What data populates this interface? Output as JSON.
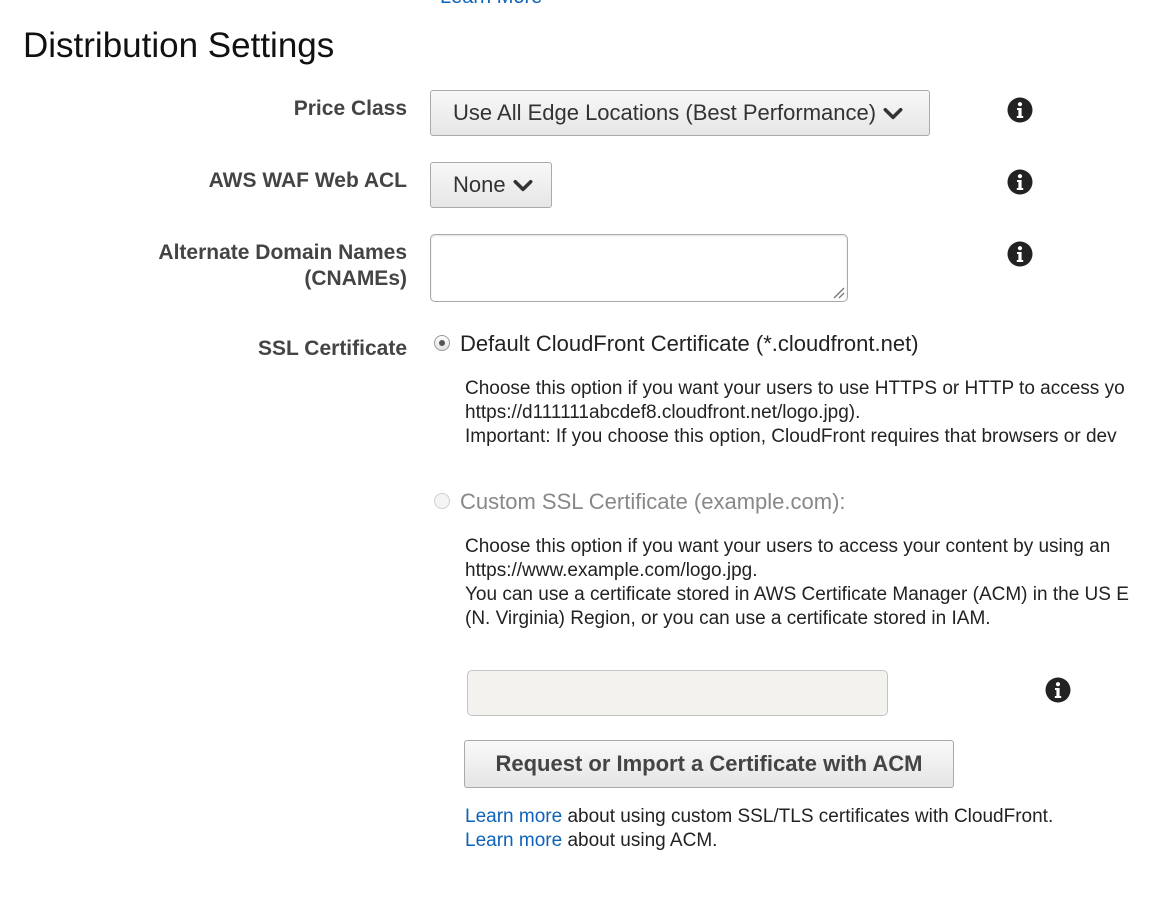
{
  "top_link": "Learn More",
  "section_title": "Distribution Settings",
  "price_class": {
    "label": "Price Class",
    "value": "Use All Edge Locations (Best Performance)"
  },
  "waf": {
    "label": "AWS WAF Web ACL",
    "value": "None"
  },
  "cnames": {
    "label_line1": "Alternate Domain Names",
    "label_line2": "(CNAMEs)",
    "value": ""
  },
  "ssl": {
    "label": "SSL Certificate",
    "default_option": {
      "label": "Default CloudFront Certificate (*.cloudfront.net)",
      "selected": true,
      "desc_line1": "Choose this option if you want your users to use HTTPS or HTTP to access yo",
      "desc_line2": "https://d111111abcdef8.cloudfront.net/logo.jpg).",
      "desc_line3": "Important: If you choose this option, CloudFront requires that browsers or dev"
    },
    "custom_option": {
      "label": "Custom SSL Certificate (example.com):",
      "selected": false,
      "disabled": true,
      "desc_line1": "Choose this option if you want your users to access your content by using an",
      "desc_line2": "https://www.example.com/logo.jpg.",
      "desc_line3": "You can use a certificate stored in AWS Certificate Manager (ACM) in the US E",
      "desc_line4": "(N. Virginia) Region, or you can use a certificate stored in IAM."
    },
    "certificate_input_value": "",
    "acm_button": "Request or Import a Certificate with ACM",
    "help1_link": "Learn more",
    "help1_text": " about using custom SSL/TLS certificates with CloudFront.",
    "help2_link": "Learn more",
    "help2_text": " about using ACM."
  },
  "icons": {
    "info": "info-icon",
    "chevron": "chevron-down-icon",
    "resize": "resize-grip-icon"
  },
  "colors": {
    "link": "#0e63b8",
    "label": "#444444",
    "icon": "#222222"
  }
}
